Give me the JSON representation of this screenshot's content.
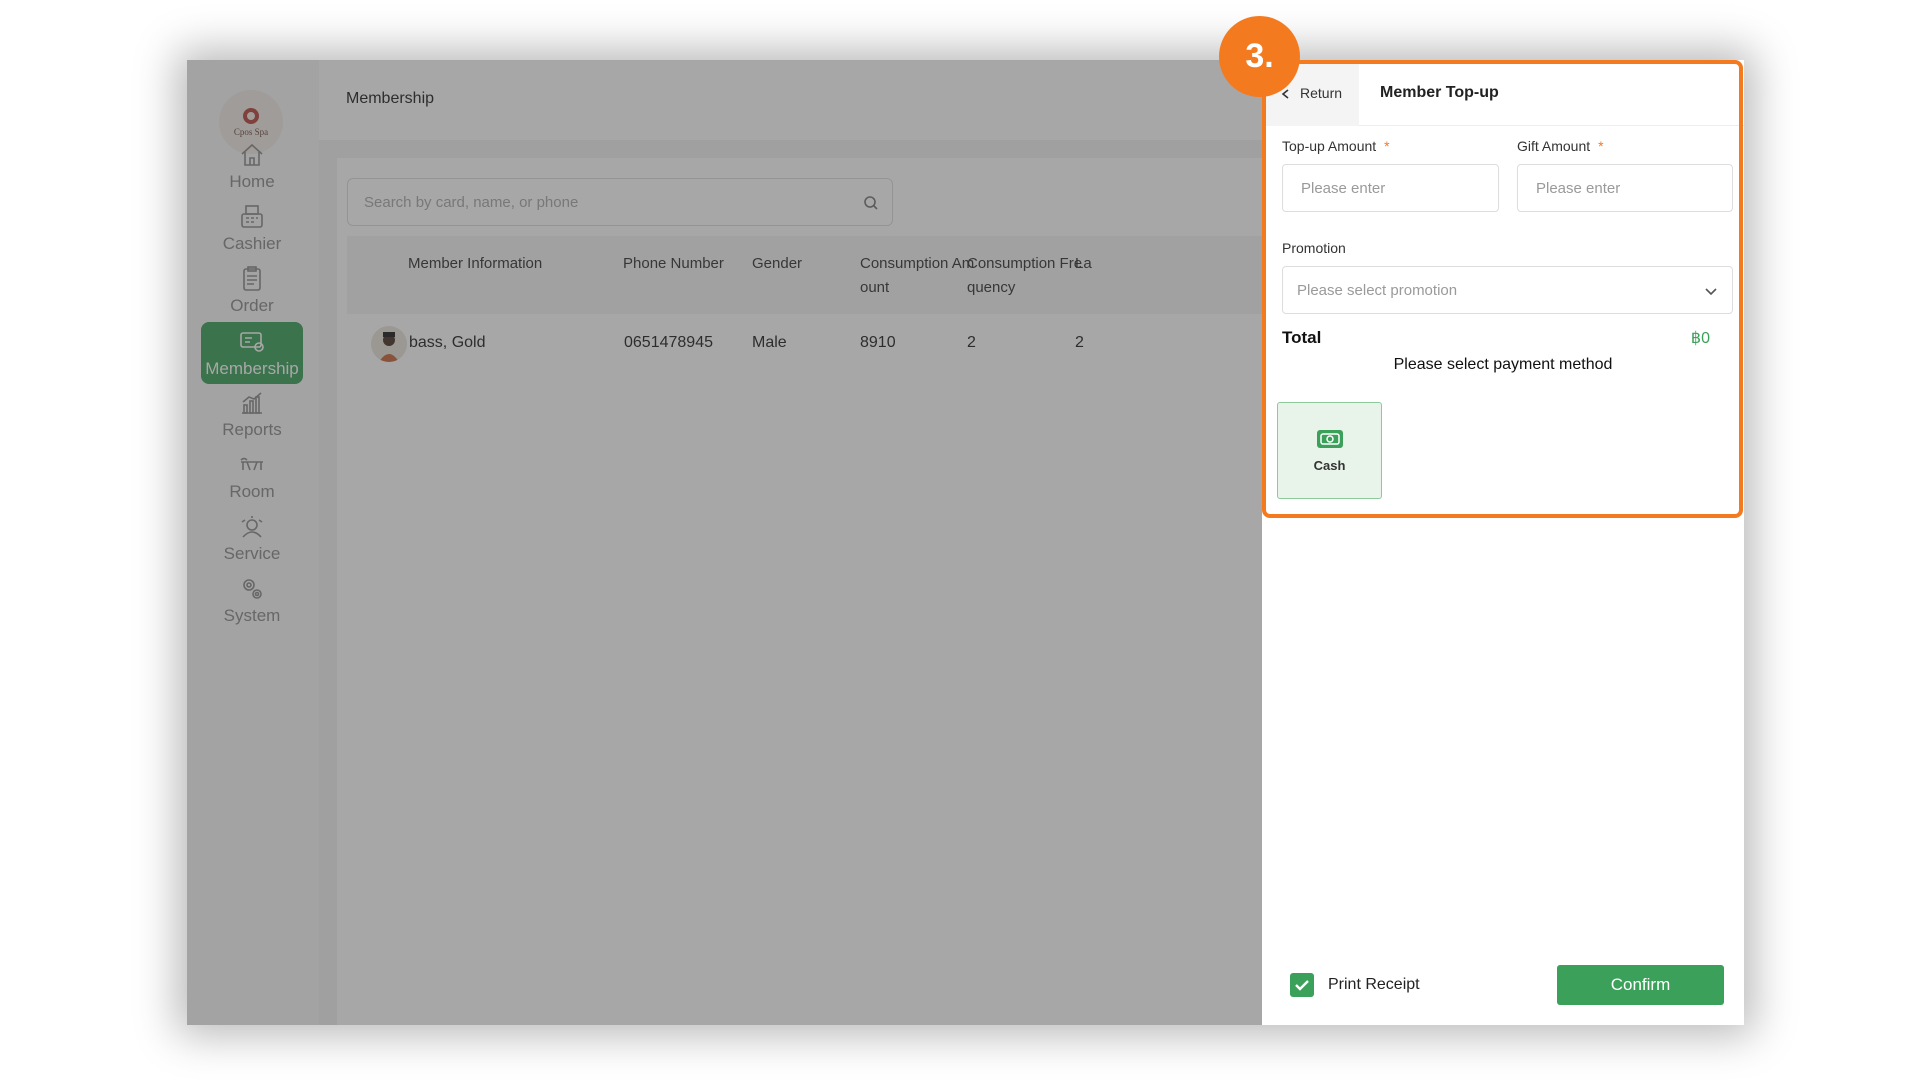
{
  "sidebar": {
    "logo_text": "Cpos Spa",
    "items": [
      {
        "label": "Home",
        "icon": "home-icon"
      },
      {
        "label": "Cashier",
        "icon": "cashier-icon"
      },
      {
        "label": "Order",
        "icon": "order-icon"
      },
      {
        "label": "Membership",
        "icon": "membership-icon",
        "active": true
      },
      {
        "label": "Reports",
        "icon": "reports-icon"
      },
      {
        "label": "Room",
        "icon": "room-icon"
      },
      {
        "label": "Service",
        "icon": "service-icon"
      },
      {
        "label": "System",
        "icon": "system-icon"
      }
    ]
  },
  "header": {
    "title": "Membership"
  },
  "search": {
    "placeholder": "Search by card, name, or phone"
  },
  "table": {
    "columns": [
      "Member Information",
      "Phone Number",
      "Gender",
      "Consumption Am\nount",
      "Consumption Fre\nquency",
      "La"
    ],
    "rows": [
      {
        "name": "bass, Gold",
        "phone": "0651478945",
        "gender": "Male",
        "amount": "8910",
        "frequency": "2",
        "last": "2"
      }
    ]
  },
  "panel": {
    "return_label": "Return",
    "title": "Member Top-up",
    "topup_label": "Top-up Amount",
    "gift_label": "Gift Amount",
    "required_mark": "*",
    "input_placeholder": "Please enter",
    "promotion_label": "Promotion",
    "promotion_placeholder": "Please select promotion",
    "total_label": "Total",
    "total_value": "฿0",
    "payment_hint": "Please select payment method",
    "payment_methods": [
      {
        "label": "Cash",
        "icon": "cash-icon"
      }
    ],
    "print_receipt_label": "Print Receipt",
    "print_receipt_checked": true,
    "confirm_label": "Confirm"
  },
  "annotation": {
    "step": "3.",
    "color": "#f47a20"
  },
  "colors": {
    "brand_green": "#3ba05a",
    "accent_orange": "#f47a20"
  }
}
